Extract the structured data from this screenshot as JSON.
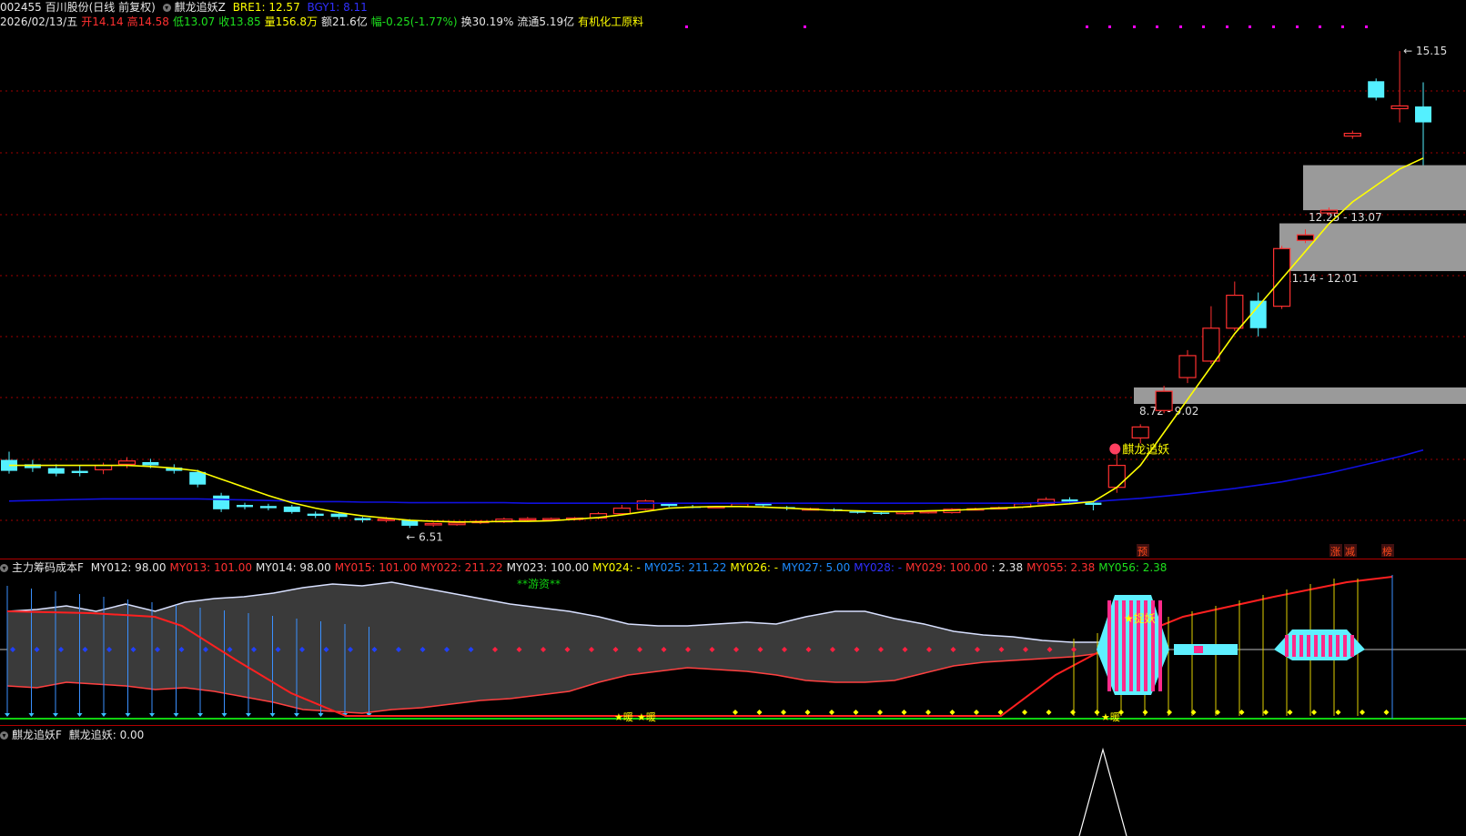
{
  "header": {
    "code_name": "002455 百川股份(日线 前复权)",
    "indicator_name": "麒龙追妖Z",
    "bre1": "BRE1: 12.57",
    "bgy1": "BGY1: 8.11",
    "date": "2026/02/13/五",
    "open": "开14.14",
    "high": "高14.58",
    "low": "低13.07",
    "close": "收13.85",
    "volume": "量156.8万",
    "amount": "额21.6亿",
    "change": "幅-0.25(-1.77%)",
    "turnover": "换30.19%",
    "float": "流通5.19亿",
    "sector": "有机化工原料"
  },
  "main_chart": {
    "price_high_label": "15.15",
    "price_low_label": "6.51",
    "zone_labels": [
      "12.25 - 13.07",
      "11.14 - 12.01",
      "8.72 - 9.02"
    ],
    "signal_label": "麒龙追妖",
    "bottom_markers": [
      "预",
      "涨",
      "减",
      "榜"
    ]
  },
  "sub1": {
    "title": "主力筹码成本F",
    "values": [
      {
        "label": "MY012: 98.00",
        "color": "#e6e6e6"
      },
      {
        "label": "MY013: 101.00",
        "color": "#ff3030"
      },
      {
        "label": "MY014: 98.00",
        "color": "#e6e6e6"
      },
      {
        "label": "MY015: 101.00",
        "color": "#ff3030"
      },
      {
        "label": "MY022: 211.22",
        "color": "#ff3030"
      },
      {
        "label": "MY023: 100.00",
        "color": "#e6e6e6"
      },
      {
        "label": "MY024: -",
        "color": "#ffff00"
      },
      {
        "label": "MY025: 211.22",
        "color": "#1e8cff"
      },
      {
        "label": "MY026: -",
        "color": "#ffff00"
      },
      {
        "label": "MY027: 5.00",
        "color": "#1e8cff"
      },
      {
        "label": "MY028: -",
        "color": "#3030ff"
      },
      {
        "label": "MY029: 100.00",
        "color": "#ff3030"
      },
      {
        "label": ": 2.38",
        "color": "#e6e6e6"
      },
      {
        "label": "MY055: 2.38",
        "color": "#ff3030"
      },
      {
        "label": "MY056: 2.38",
        "color": "#1ee01e"
      }
    ],
    "center_label": "**游资**",
    "capture_label": "★捉妖",
    "small_markers": [
      "★暖",
      "★暖",
      "★暖"
    ]
  },
  "sub2": {
    "title": "麒龙追妖F",
    "value_label": "麒龙追妖: 0.00"
  },
  "colors": {
    "up": "#ff3030",
    "down": "#54f0ff",
    "ma_yellow": "#ffff00",
    "ma_blue": "#1010e0",
    "zone": "#9a9a9a",
    "grid": "#a00000"
  },
  "chart_data": {
    "type": "candlestick",
    "dates": [],
    "candles": [
      [
        7.7,
        7.5,
        7.85,
        7.45
      ],
      [
        7.62,
        7.55,
        7.7,
        7.48
      ],
      [
        7.55,
        7.45,
        7.62,
        7.4
      ],
      [
        7.5,
        7.46,
        7.6,
        7.4
      ],
      [
        7.52,
        7.6,
        7.65,
        7.44
      ],
      [
        7.62,
        7.68,
        7.75,
        7.55
      ],
      [
        7.66,
        7.6,
        7.72,
        7.55
      ],
      [
        7.56,
        7.5,
        7.62,
        7.45
      ],
      [
        7.48,
        7.25,
        7.52,
        7.2
      ],
      [
        7.05,
        6.8,
        7.1,
        6.75
      ],
      [
        6.88,
        6.84,
        6.92,
        6.8
      ],
      [
        6.86,
        6.82,
        6.9,
        6.78
      ],
      [
        6.85,
        6.75,
        6.88,
        6.72
      ],
      [
        6.72,
        6.68,
        6.76,
        6.64
      ],
      [
        6.72,
        6.66,
        6.75,
        6.62
      ],
      [
        6.64,
        6.6,
        6.66,
        6.56
      ],
      [
        6.6,
        6.62,
        6.66,
        6.56
      ],
      [
        6.6,
        6.5,
        6.62,
        6.46
      ],
      [
        6.52,
        6.54,
        6.56,
        6.48
      ],
      [
        6.52,
        6.55,
        6.58,
        6.5
      ],
      [
        6.56,
        6.58,
        6.6,
        6.53
      ],
      [
        6.57,
        6.62,
        6.65,
        6.55
      ],
      [
        6.61,
        6.63,
        6.66,
        6.59
      ],
      [
        6.62,
        6.63,
        6.65,
        6.6
      ],
      [
        6.62,
        6.64,
        6.66,
        6.6
      ],
      [
        6.64,
        6.72,
        6.75,
        6.62
      ],
      [
        6.72,
        6.82,
        6.88,
        6.7
      ],
      [
        6.8,
        6.95,
        6.98,
        6.78
      ],
      [
        6.9,
        6.86,
        6.92,
        6.84
      ],
      [
        6.85,
        6.84,
        6.88,
        6.82
      ],
      [
        6.84,
        6.85,
        6.86,
        6.82
      ],
      [
        6.85,
        6.9,
        6.92,
        6.84
      ],
      [
        6.9,
        6.87,
        6.92,
        6.84
      ],
      [
        6.84,
        6.82,
        6.86,
        6.78
      ],
      [
        6.8,
        6.81,
        6.83,
        6.78
      ],
      [
        6.8,
        6.78,
        6.82,
        6.76
      ],
      [
        6.76,
        6.74,
        6.78,
        6.72
      ],
      [
        6.74,
        6.72,
        6.76,
        6.7
      ],
      [
        6.72,
        6.75,
        6.77,
        6.7
      ],
      [
        6.74,
        6.76,
        6.78,
        6.72
      ],
      [
        6.74,
        6.8,
        6.82,
        6.72
      ],
      [
        6.8,
        6.81,
        6.83,
        6.78
      ],
      [
        6.82,
        6.83,
        6.85,
        6.8
      ],
      [
        6.84,
        6.9,
        6.93,
        6.82
      ],
      [
        6.9,
        6.98,
        7.02,
        6.88
      ],
      [
        6.98,
        6.94,
        7.02,
        6.9
      ],
      [
        6.92,
        6.88,
        6.95,
        6.78
      ],
      [
        7.2,
        7.6,
        7.8,
        7.1
      ],
      [
        8.1,
        8.3,
        8.35,
        8.0
      ],
      [
        8.6,
        8.95,
        9.05,
        8.55
      ],
      [
        9.2,
        9.6,
        9.7,
        9.1
      ],
      [
        9.5,
        10.1,
        10.5,
        9.45
      ],
      [
        10.1,
        10.7,
        10.95,
        10.05
      ],
      [
        10.6,
        10.1,
        10.75,
        9.95
      ],
      [
        10.5,
        11.55,
        11.6,
        10.45
      ],
      [
        11.7,
        11.8,
        11.9,
        11.65
      ],
      [
        12.2,
        12.25,
        12.3,
        12.15
      ],
      [
        13.6,
        13.65,
        13.7,
        13.55
      ],
      [
        14.6,
        14.3,
        14.65,
        14.25
      ],
      [
        14.1,
        14.15,
        15.15,
        13.85
      ],
      [
        14.14,
        13.85,
        14.58,
        13.07
      ]
    ],
    "ma_yellow": [
      7.6,
      7.6,
      7.6,
      7.6,
      7.6,
      7.6,
      7.58,
      7.55,
      7.5,
      7.35,
      7.2,
      7.05,
      6.92,
      6.82,
      6.74,
      6.68,
      6.64,
      6.6,
      6.58,
      6.57,
      6.57,
      6.58,
      6.58,
      6.59,
      6.62,
      6.65,
      6.7,
      6.76,
      6.82,
      6.84,
      6.85,
      6.85,
      6.84,
      6.82,
      6.8,
      6.78,
      6.77,
      6.76,
      6.76,
      6.77,
      6.78,
      6.8,
      6.82,
      6.84,
      6.87,
      6.9,
      6.94,
      7.2,
      7.6,
      8.2,
      8.8,
      9.4,
      10.0,
      10.5,
      11.0,
      11.5,
      12.0,
      12.4,
      12.7,
      13.0,
      13.2
    ],
    "ma_blue": [
      6.95,
      6.96,
      6.97,
      6.98,
      6.99,
      6.99,
      6.99,
      6.99,
      6.99,
      6.98,
      6.97,
      6.96,
      6.95,
      6.94,
      6.94,
      6.93,
      6.93,
      6.92,
      6.92,
      6.92,
      6.92,
      6.92,
      6.91,
      6.91,
      6.91,
      6.91,
      6.91,
      6.91,
      6.91,
      6.91,
      6.91,
      6.91,
      6.91,
      6.91,
      6.91,
      6.91,
      6.91,
      6.91,
      6.91,
      6.91,
      6.91,
      6.91,
      6.91,
      6.91,
      6.92,
      6.93,
      6.94,
      6.97,
      7.0,
      7.04,
      7.08,
      7.13,
      7.18,
      7.24,
      7.3,
      7.38,
      7.46,
      7.56,
      7.66,
      7.76,
      7.88
    ],
    "zones": [
      [
        12.25,
        13.07
      ],
      [
        11.14,
        12.01
      ],
      [
        8.72,
        9.02
      ]
    ],
    "ylim": [
      6.3,
      15.5
    ]
  }
}
